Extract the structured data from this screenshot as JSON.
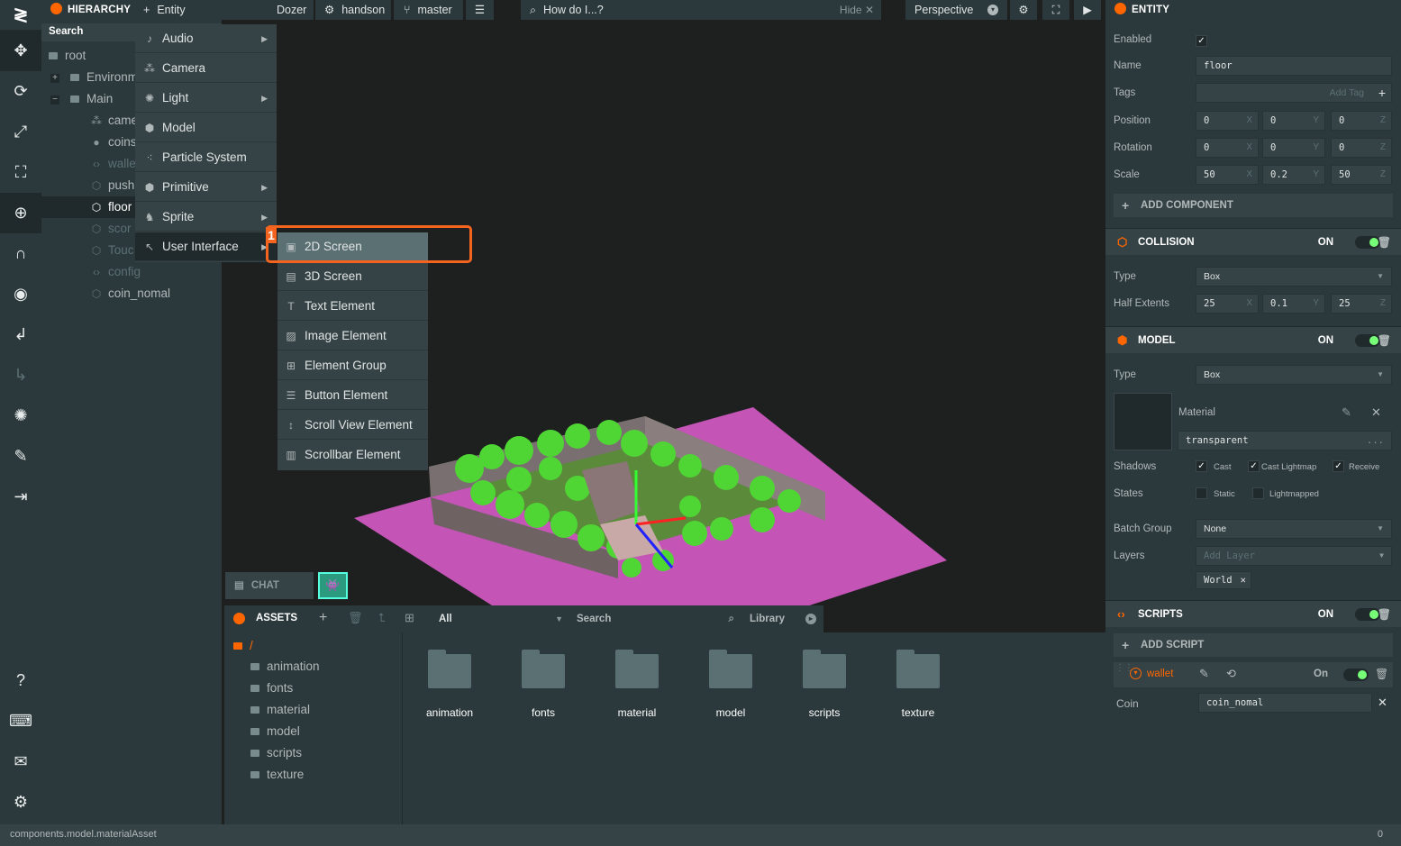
{
  "hierarchy": {
    "title": "HIERARCHY",
    "search": "Search",
    "items": [
      {
        "label": "root"
      },
      {
        "label": "Environm",
        "expand": "+"
      },
      {
        "label": "Main",
        "expand": "−"
      },
      {
        "label": "came"
      },
      {
        "label": "coins"
      },
      {
        "label": "walle"
      },
      {
        "label": "push"
      },
      {
        "label": "floor"
      },
      {
        "label": "scor"
      },
      {
        "label": "Touc"
      },
      {
        "label": "config"
      },
      {
        "label": "coin_nomal"
      }
    ]
  },
  "topbar": {
    "entity_menu": "Entity",
    "project": "Dozer",
    "user": "handson",
    "branch": "master",
    "help_search": "How do I...?",
    "hide": "Hide",
    "camera": "Perspective"
  },
  "entity_menu": {
    "items": [
      {
        "label": "Audio",
        "submenu": true,
        "icon": "audio-icon"
      },
      {
        "label": "Camera",
        "submenu": false,
        "icon": "camera-icon"
      },
      {
        "label": "Light",
        "submenu": true,
        "icon": "light-icon"
      },
      {
        "label": "Model",
        "submenu": false,
        "icon": "model-icon"
      },
      {
        "label": "Particle System",
        "submenu": false,
        "icon": "particle-icon"
      },
      {
        "label": "Primitive",
        "submenu": true,
        "icon": "primitive-icon"
      },
      {
        "label": "Sprite",
        "submenu": true,
        "icon": "sprite-icon"
      },
      {
        "label": "User Interface",
        "submenu": true,
        "icon": "cursor-icon"
      }
    ]
  },
  "ui_submenu": {
    "items": [
      {
        "label": "2D Screen"
      },
      {
        "label": "3D Screen"
      },
      {
        "label": "Text Element"
      },
      {
        "label": "Image Element"
      },
      {
        "label": "Element Group"
      },
      {
        "label": "Button Element"
      },
      {
        "label": "Scroll View Element"
      },
      {
        "label": "Scrollbar Element"
      }
    ]
  },
  "annotation": {
    "step": "1",
    "color": "#f5641f"
  },
  "chat": {
    "label": "CHAT"
  },
  "assets": {
    "title": "ASSETS",
    "filter": "All",
    "search": "Search",
    "library": "Library",
    "root": "/",
    "folders": [
      "animation",
      "fonts",
      "material",
      "model",
      "scripts",
      "texture"
    ]
  },
  "inspector": {
    "title": "ENTITY",
    "enabled_label": "Enabled",
    "name_label": "Name",
    "name_value": "floor",
    "tags_label": "Tags",
    "add_tag": "Add Tag",
    "position_label": "Position",
    "position": [
      "0",
      "0",
      "0"
    ],
    "rotation_label": "Rotation",
    "rotation": [
      "0",
      "0",
      "0"
    ],
    "scale_label": "Scale",
    "scale": [
      "50",
      "0.2",
      "50"
    ],
    "axes": [
      "X",
      "Y",
      "Z"
    ],
    "add_component": "ADD COMPONENT",
    "collision": {
      "title": "COLLISION",
      "on": "ON",
      "type_label": "Type",
      "type": "Box",
      "half_label": "Half Extents",
      "half": [
        "25",
        "0.1",
        "25"
      ]
    },
    "model": {
      "title": "MODEL",
      "on": "ON",
      "type_label": "Type",
      "type": "Box",
      "material_label": "Material",
      "material": "transparent",
      "material_more": "...",
      "shadows_label": "Shadows",
      "cast": "Cast",
      "cast_lightmap": "Cast Lightmap",
      "receive": "Receive",
      "states_label": "States",
      "static": "Static",
      "lightmapped": "Lightmapped",
      "batch_label": "Batch Group",
      "batch": "None",
      "layers_label": "Layers",
      "add_layer": "Add Layer",
      "layer_tag": "World"
    },
    "scripts": {
      "title": "SCRIPTS",
      "on": "ON",
      "add_script": "ADD SCRIPT",
      "script_name": "wallet",
      "script_on": "On",
      "coin_label": "Coin",
      "coin_value": "coin_nomal"
    }
  },
  "status": {
    "path": "components.model.materialAsset",
    "count": "0"
  }
}
